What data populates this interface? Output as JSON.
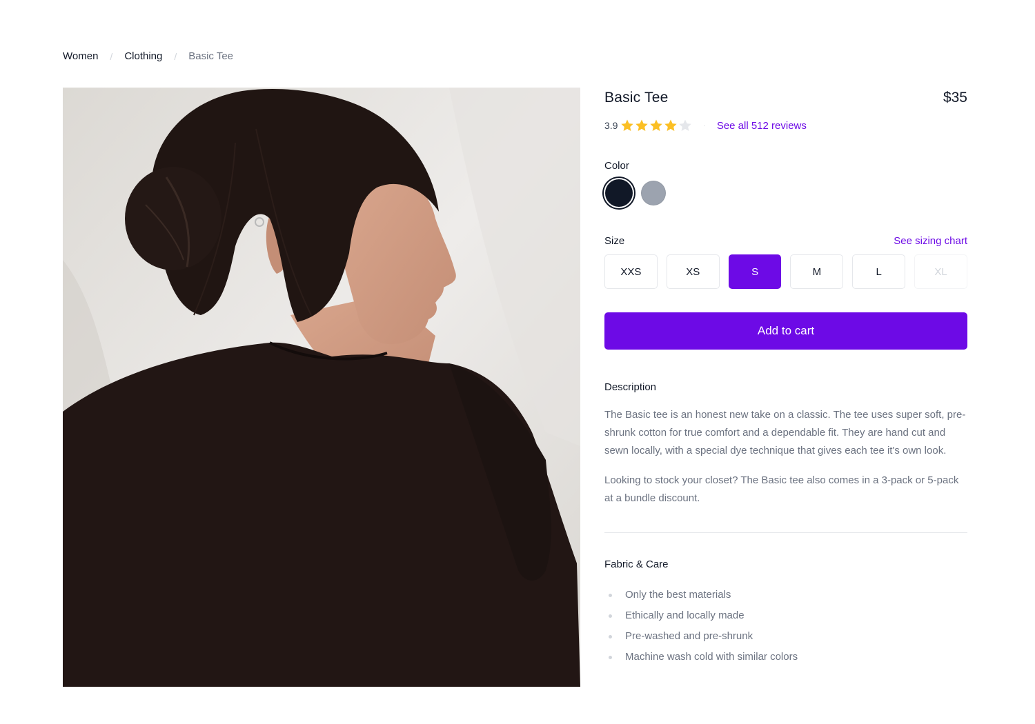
{
  "breadcrumb": {
    "items": [
      "Women",
      "Clothing"
    ],
    "separator": "/",
    "current": "Basic Tee"
  },
  "product": {
    "name": "Basic Tee",
    "price": "$35",
    "rating": {
      "value": "3.9",
      "stars_filled": 4,
      "stars_total": 5,
      "reviews_link": "See all 512 reviews"
    },
    "image": {
      "icon": "product-photo"
    }
  },
  "color": {
    "label": "Color",
    "options": [
      {
        "value": "#111827",
        "selected": true
      },
      {
        "value": "#9ca3af",
        "selected": false
      }
    ]
  },
  "size": {
    "label": "Size",
    "chart_link": "See sizing chart",
    "options": [
      {
        "label": "XXS",
        "state": "available"
      },
      {
        "label": "XS",
        "state": "available"
      },
      {
        "label": "S",
        "state": "selected"
      },
      {
        "label": "M",
        "state": "available"
      },
      {
        "label": "L",
        "state": "available"
      },
      {
        "label": "XL",
        "state": "disabled"
      }
    ]
  },
  "cart": {
    "button_label": "Add to cart"
  },
  "description": {
    "heading": "Description",
    "paragraphs": [
      "The Basic tee is an honest new take on a classic. The tee uses super soft, pre-shrunk cotton for true comfort and a dependable fit. They are hand cut and sewn locally, with a special dye technique that gives each tee it's own look.",
      "Looking to stock your closet? The Basic tee also comes in a 3-pack or 5-pack at a bundle discount."
    ]
  },
  "fabric": {
    "heading": "Fabric & Care",
    "items": [
      "Only the best materials",
      "Ethically and locally made",
      "Pre-washed and pre-shrunk",
      "Machine wash cold with similar colors"
    ]
  },
  "colors": {
    "accent": "#6d0ae6",
    "star_filled": "#fbbf24",
    "star_empty": "#e5e7eb",
    "text_primary": "#111827",
    "text_muted": "#6b7280"
  }
}
